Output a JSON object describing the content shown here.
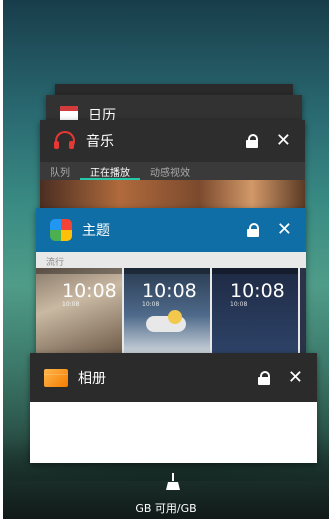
{
  "recents": {
    "calendar": {
      "title": "日历"
    },
    "music": {
      "title": "音乐",
      "tabs": [
        "队列",
        "正在播放",
        "动感视效"
      ],
      "active_tab": 1
    },
    "theme": {
      "title": "主题",
      "section": "流行",
      "thumbs": [
        {
          "time": "10:08",
          "date": "10:08"
        },
        {
          "time": "10:08",
          "date": "10:08"
        },
        {
          "time": "10:08",
          "date": "10:08"
        }
      ]
    },
    "album": {
      "title": "相册"
    }
  },
  "footer": {
    "memory": "GB 可用/GB"
  },
  "colors": {
    "theme_header": "#0f6ea6",
    "music_accent": "#26c6a8",
    "music_icon": "#e53935"
  }
}
